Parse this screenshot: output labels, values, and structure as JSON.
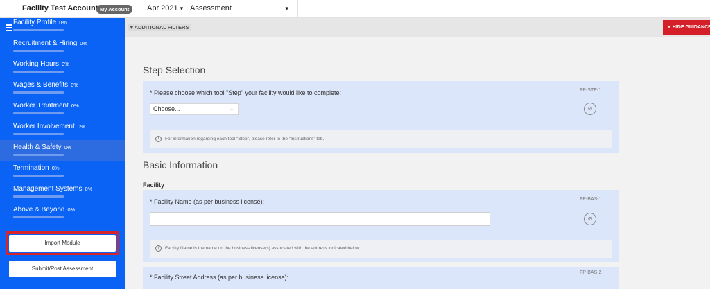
{
  "topbar": {
    "account_name": "Facility Test Account 2",
    "my_account_label": "My Account",
    "month": "Apr 2021",
    "assessment": "Assessment"
  },
  "sidebar": {
    "items": [
      {
        "label": "Facility Profile",
        "percent": "0%",
        "progress": 0
      },
      {
        "label": "Recruitment & Hiring",
        "percent": "0%",
        "progress": 0
      },
      {
        "label": "Working Hours",
        "percent": "0%",
        "progress": 0
      },
      {
        "label": "Wages & Benefits",
        "percent": "0%",
        "progress": 0
      },
      {
        "label": "Worker Treatment",
        "percent": "0%",
        "progress": 0
      },
      {
        "label": "Worker Involvement",
        "percent": "0%",
        "progress": 0
      },
      {
        "label": "Health & Safety",
        "percent": "0%",
        "progress": 0
      },
      {
        "label": "Termination",
        "percent": "0%",
        "progress": 0
      },
      {
        "label": "Management Systems",
        "percent": "0%",
        "progress": 0
      },
      {
        "label": "Above & Beyond",
        "percent": "0%",
        "progress": 0
      }
    ],
    "import_label": "Import Module",
    "submit_label": "Submit/Post Assessment"
  },
  "filters": {
    "additional_filters_label": "▾ ADDITIONAL FILTERS",
    "hide_guidance_label": "✕  HIDE GUIDANCE"
  },
  "step_selection": {
    "title": "Step Selection",
    "question": "* Please choose which tool \"Step\" your facility would like to complete:",
    "code": "FP-STE-1",
    "select_value": "Choose...",
    "note": "For information regarding each tool \"Step\", please refer to the \"Instructions\" tab."
  },
  "basic_information": {
    "title": "Basic Information",
    "subsection": "Facility",
    "facility_name": {
      "question": "* Facility Name (as per business license):",
      "code": "FP-BAS-1",
      "value": "",
      "note": "Facility Name is the name on the business license(s) associated with the address indicated below."
    },
    "street_address": {
      "question": "* Facility Street Address (as per business license):",
      "code": "FP-BAS-2"
    }
  },
  "colors": {
    "sidebar": "#0a63f5",
    "highlight": "#d7262b",
    "hide_guidance": "#d41f28",
    "question_box": "#dce6fa"
  }
}
